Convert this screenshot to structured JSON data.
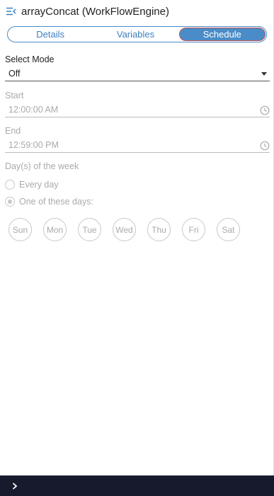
{
  "header": {
    "title": "arrayConcat (WorkFlowEngine)",
    "icon": "panel-collapse-icon"
  },
  "tabs": [
    {
      "label": "Details",
      "active": false
    },
    {
      "label": "Variables",
      "active": false
    },
    {
      "label": "Schedule",
      "active": true
    }
  ],
  "mode": {
    "label": "Select Mode",
    "value": "Off"
  },
  "start": {
    "label": "Start",
    "value": "12:00:00 AM",
    "icon": "clock-icon"
  },
  "end": {
    "label": "End",
    "value": "12:59:00 PM",
    "icon": "clock-icon"
  },
  "days": {
    "label": "Day(s) of the week",
    "every_day": "Every day",
    "one_of": "One of these days:",
    "selected_option": "one_of",
    "items": [
      "Sun",
      "Mon",
      "Tue",
      "Wed",
      "Thu",
      "Fri",
      "Sat"
    ]
  },
  "footer": {
    "icon": "chevron-right-icon"
  },
  "colors": {
    "accent": "#4a8cc8",
    "footer_bg": "#161a2c",
    "disabled_text": "#aaaaaa"
  }
}
